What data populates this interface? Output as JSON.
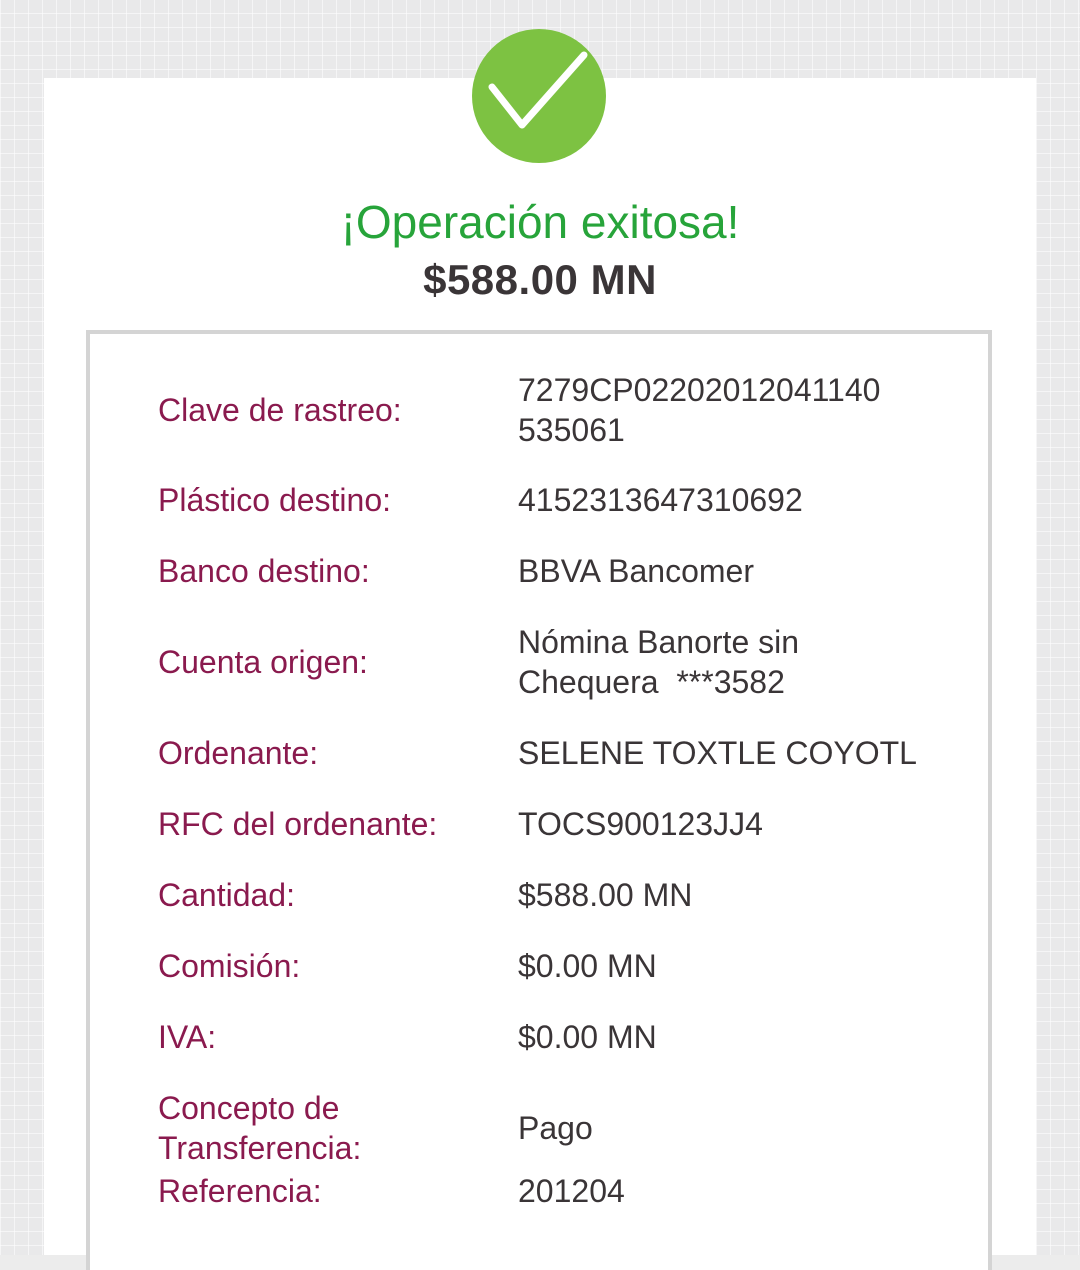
{
  "status": {
    "title": "¡Operación exitosa!",
    "amount": "$588.00 MN"
  },
  "colors": {
    "success_green": "#7dc242",
    "title_green": "#27a43a",
    "label_maroon": "#8a1a4e",
    "value_gray": "#3a3537"
  },
  "details": {
    "clave_rastreo": {
      "label": "Clave de rastreo:",
      "value_line1": "7279CP02202012041140",
      "value_line2": "535061"
    },
    "plastico_destino": {
      "label": "Plástico destino:",
      "value": "4152313647310692"
    },
    "banco_destino": {
      "label": "Banco destino:",
      "value": "BBVA Bancomer"
    },
    "cuenta_origen": {
      "label": "Cuenta origen:",
      "value_line1": "Nómina Banorte sin",
      "value_line2": "Chequera  ***3582"
    },
    "ordenante": {
      "label": "Ordenante:",
      "value": "SELENE TOXTLE COYOTL"
    },
    "rfc_ordenante": {
      "label": "RFC del ordenante:",
      "value": "TOCS900123JJ4"
    },
    "cantidad": {
      "label": "Cantidad:",
      "value": "$588.00 MN"
    },
    "comision": {
      "label": "Comisión:",
      "value": "$0.00 MN"
    },
    "iva": {
      "label": "IVA:",
      "value": "$0.00 MN"
    },
    "concepto": {
      "label_line1": "Concepto de",
      "label_line2": "Transferencia:",
      "value": "Pago"
    },
    "referencia": {
      "label": "Referencia:",
      "value": "201204"
    }
  }
}
